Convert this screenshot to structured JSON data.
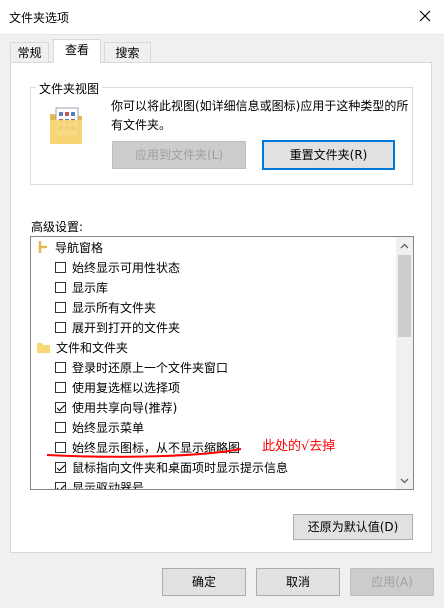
{
  "window": {
    "title": "文件夹选项"
  },
  "tabs": [
    {
      "label": "常规",
      "active": false
    },
    {
      "label": "查看",
      "active": true
    },
    {
      "label": "搜索",
      "active": false
    }
  ],
  "folder_view": {
    "title": "文件夹视图",
    "description": "你可以将此视图(如详细信息或图标)应用于这种类型的所有文件夹。",
    "apply_button": "应用到文件夹(L)",
    "reset_button": "重置文件夹(R)"
  },
  "advanced": {
    "label": "高级设置:",
    "items": [
      {
        "type": "category",
        "label": "导航窗格",
        "icon": "navigation-pane-icon"
      },
      {
        "type": "checkbox",
        "label": "始终显示可用性状态",
        "checked": false
      },
      {
        "type": "checkbox",
        "label": "显示库",
        "checked": false
      },
      {
        "type": "checkbox",
        "label": "显示所有文件夹",
        "checked": false
      },
      {
        "type": "checkbox",
        "label": "展开到打开的文件夹",
        "checked": false
      },
      {
        "type": "category",
        "label": "文件和文件夹",
        "icon": "folder-icon"
      },
      {
        "type": "checkbox",
        "label": "登录时还原上一个文件夹窗口",
        "checked": false
      },
      {
        "type": "checkbox",
        "label": "使用复选框以选择项",
        "checked": false
      },
      {
        "type": "checkbox",
        "label": "使用共享向导(推荐)",
        "checked": true
      },
      {
        "type": "checkbox",
        "label": "始终显示菜单",
        "checked": false
      },
      {
        "type": "checkbox",
        "label": "始终显示图标，从不显示缩略图",
        "checked": false
      },
      {
        "type": "checkbox",
        "label": "鼠标指向文件夹和桌面项时显示提示信息",
        "checked": true
      },
      {
        "type": "checkbox",
        "label": "显示驱动器号",
        "checked": true
      }
    ]
  },
  "annotation": {
    "text": "此处的√去掉",
    "color": "#ff0000"
  },
  "restore_defaults_button": "还原为默认值(D)",
  "footer": {
    "ok": "确定",
    "cancel": "取消",
    "apply": "应用(A)"
  },
  "colors": {
    "accent": "#0078d7",
    "annotation": "#ff0000",
    "folder": "#f8d775"
  }
}
